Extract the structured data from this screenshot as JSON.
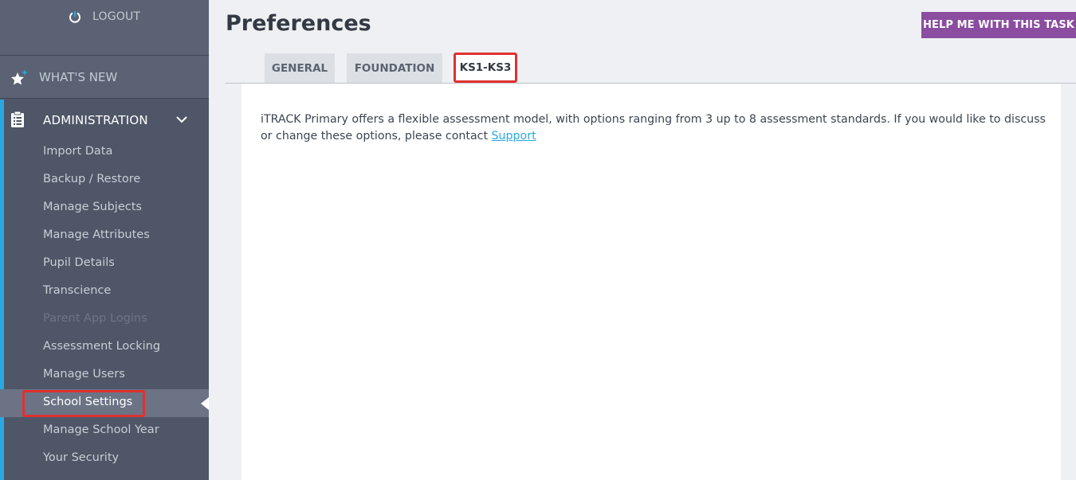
{
  "sidebar": {
    "logout_label": "LOGOUT",
    "whats_new_label": "WHAT'S NEW",
    "admin_label": "ADMINISTRATION",
    "items": [
      {
        "label": "Import Data",
        "state": "normal"
      },
      {
        "label": "Backup / Restore",
        "state": "normal"
      },
      {
        "label": "Manage Subjects",
        "state": "normal"
      },
      {
        "label": "Manage Attributes",
        "state": "normal"
      },
      {
        "label": "Pupil Details",
        "state": "normal"
      },
      {
        "label": "Transcience",
        "state": "normal"
      },
      {
        "label": "Parent App Logins",
        "state": "disabled"
      },
      {
        "label": "Assessment Locking",
        "state": "normal"
      },
      {
        "label": "Manage Users",
        "state": "normal"
      },
      {
        "label": "School Settings",
        "state": "active"
      },
      {
        "label": "Manage School Year",
        "state": "normal"
      },
      {
        "label": "Your Security",
        "state": "normal"
      }
    ]
  },
  "main": {
    "title": "Preferences",
    "help_label": "HELP ME WITH THIS TASK",
    "tabs": [
      {
        "label": "GENERAL",
        "active": false
      },
      {
        "label": "FOUNDATION",
        "active": false
      },
      {
        "label": "KS1-KS3",
        "active": true
      }
    ],
    "body_text": "iTRACK Primary offers a flexible assessment model, with options ranging from 3 up to 8 assessment standards. If you would like to discuss or change these options, please contact ",
    "link_text": "Support"
  },
  "colors": {
    "accent": "#29a8e0",
    "help_button": "#8a4da0",
    "highlight": "#e0312f",
    "sidebar_bg": "#4e5667"
  },
  "icons": {
    "logout": "power-icon",
    "whats_new": "star-sparkle-icon",
    "administration": "clipboard-icon",
    "expand": "chevron-down-icon"
  }
}
